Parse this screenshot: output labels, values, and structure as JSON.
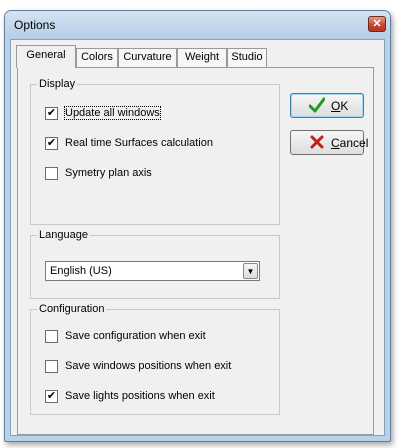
{
  "window": {
    "title": "Options"
  },
  "tabs": [
    "General",
    "Colors",
    "Curvature",
    "Weight",
    "Studio"
  ],
  "display": {
    "title": "Display",
    "options": [
      {
        "label": "Update all windows",
        "checked": true
      },
      {
        "label": "Real time Surfaces calculation",
        "checked": true
      },
      {
        "label": "Symetry plan axis",
        "checked": false
      }
    ]
  },
  "language": {
    "title": "Language",
    "selected": "English (US)"
  },
  "configuration": {
    "title": "Configuration",
    "options": [
      {
        "label": "Save configuration when exit",
        "checked": false
      },
      {
        "label": "Save windows positions when exit",
        "checked": false
      },
      {
        "label": "Save lights positions when exit",
        "checked": true
      }
    ]
  },
  "buttons": {
    "ok": {
      "mnemonic": "O",
      "rest": "K"
    },
    "cancel": {
      "mnemonic": "C",
      "rest": "ancel"
    }
  },
  "icons": {
    "ok": "checkmark-icon",
    "cancel": "x-icon",
    "close": "close-icon",
    "dropdown": "chevron-down-icon"
  },
  "colors": {
    "ok_icon": "#1f9a2a",
    "cancel_icon": "#c0201a",
    "close_button": "#c9452f"
  }
}
